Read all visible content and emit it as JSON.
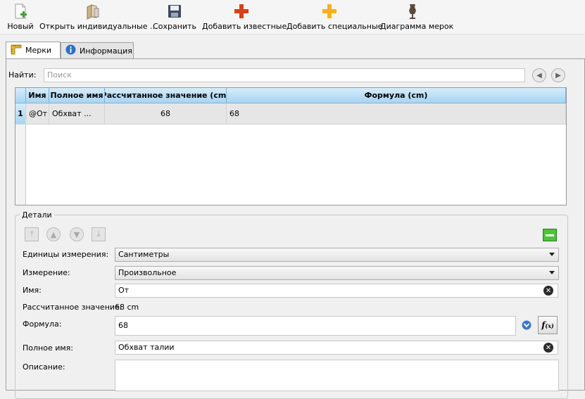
{
  "toolbar": {
    "new": "Новый",
    "open": "Открыть индивидуальные ...",
    "save": "Сохранить",
    "add_known": "Добавить известные",
    "add_special": "Добавить специальные",
    "diagram": "Диаграмма мерок",
    "colors": {
      "new_plus": "#3aa62f",
      "add_known": "#d8401c",
      "add_special": "#f5b21a",
      "diagram": "#5b4a3c"
    }
  },
  "tabs": [
    {
      "label": "Мерки",
      "icon": "ruler-icon",
      "active": true
    },
    {
      "label": "Информация",
      "icon": "info-icon",
      "active": false
    }
  ],
  "search": {
    "label": "Найти:",
    "placeholder": "Поиск"
  },
  "table": {
    "columns": [
      "Имя",
      "Полное имя",
      "Рассчитанное значение (cm)",
      "Формула (cm)"
    ],
    "rows": [
      {
        "index": "1",
        "name": "@От",
        "full_name": "Обхват ...",
        "value": "68",
        "formula": "68"
      }
    ]
  },
  "details": {
    "title": "Детали",
    "units_label": "Единицы измерения:",
    "units_value": "Сантиметры",
    "measurement_label": "Измерение:",
    "measurement_value": "Произвольное",
    "name_label": "Имя:",
    "name_value": "От",
    "calc_label": "Рассчитанное значение:",
    "calc_value": "68 cm",
    "formula_label": "Формула:",
    "formula_value": "68",
    "fullname_label": "Полное имя:",
    "fullname_value": "Обхват талии",
    "description_label": "Описание:",
    "description_value": ""
  }
}
